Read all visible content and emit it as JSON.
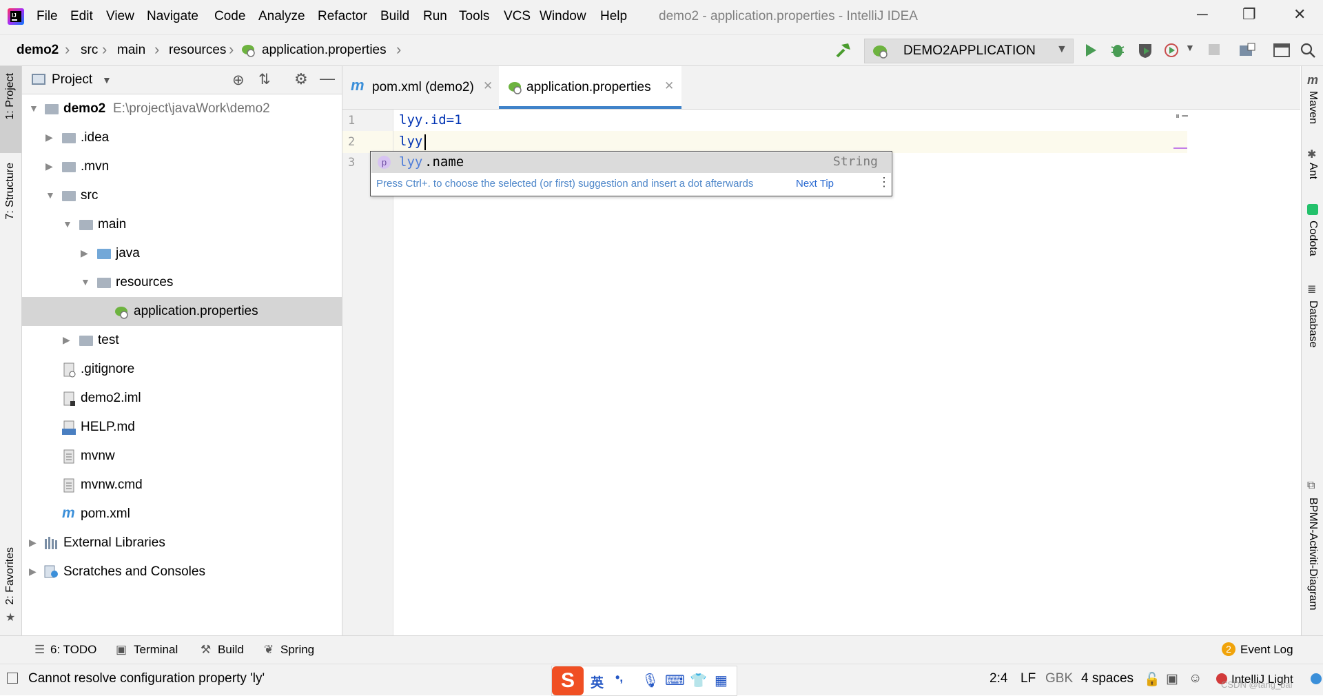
{
  "window": {
    "title": "demo2 - application.properties - IntelliJ IDEA",
    "menu": [
      "File",
      "Edit",
      "View",
      "Navigate",
      "Code",
      "Analyze",
      "Refactor",
      "Build",
      "Run",
      "Tools",
      "VCS",
      "Window",
      "Help"
    ],
    "controls": {
      "minimize": "─",
      "restore": "❐",
      "close": "✕"
    }
  },
  "breadcrumb": [
    "demo2",
    "src",
    "main",
    "resources",
    "application.properties"
  ],
  "run_config": {
    "label": "DEMO2APPLICATION"
  },
  "left_strip": {
    "project": "1: Project",
    "structure": "7: Structure",
    "favorites": "2: Favorites"
  },
  "right_strip": {
    "maven": "Maven",
    "ant": "Ant",
    "codota": "Codota",
    "database": "Database",
    "bpmn": "BPMN-Activiti-Diagram"
  },
  "project_panel": {
    "title": "Project",
    "tree": [
      {
        "label": "demo2",
        "path": "E:\\project\\javaWork\\demo2"
      },
      {
        "label": ".idea"
      },
      {
        "label": ".mvn"
      },
      {
        "label": "src"
      },
      {
        "label": "main"
      },
      {
        "label": "java"
      },
      {
        "label": "resources"
      },
      {
        "label": "application.properties"
      },
      {
        "label": "test"
      },
      {
        "label": ".gitignore"
      },
      {
        "label": "demo2.iml"
      },
      {
        "label": "HELP.md"
      },
      {
        "label": "mvnw"
      },
      {
        "label": "mvnw.cmd"
      },
      {
        "label": "pom.xml"
      },
      {
        "label": "External Libraries"
      },
      {
        "label": "Scratches and Consoles"
      }
    ]
  },
  "tabs": [
    {
      "label": "pom.xml (demo2)",
      "icon": "m"
    },
    {
      "label": "application.properties"
    }
  ],
  "editor": {
    "line_numbers": [
      "1",
      "2",
      "3"
    ],
    "lines": [
      "lyy.id=1",
      "lyy"
    ]
  },
  "completion": {
    "badge": "p",
    "match": "lyy",
    "rest": ".name",
    "type": "String",
    "hint": "Press Ctrl+. to choose the selected (or first) suggestion and insert a dot afterwards",
    "next_tip": "Next Tip"
  },
  "bottom_tools": {
    "todo": "6: TODO",
    "terminal": "Terminal",
    "build": "Build",
    "spring": "Spring",
    "event_log": "Event Log",
    "event_count": "2"
  },
  "status": {
    "message": "Cannot resolve configuration property 'ly'",
    "position": "2:4",
    "line_sep": "LF",
    "encoding": "GBK",
    "indent": "4 spaces",
    "theme": "IntelliJ Light",
    "watermark": "CSDN @tang_bai"
  },
  "ime": {
    "lang": "英",
    "punct": "•,"
  }
}
